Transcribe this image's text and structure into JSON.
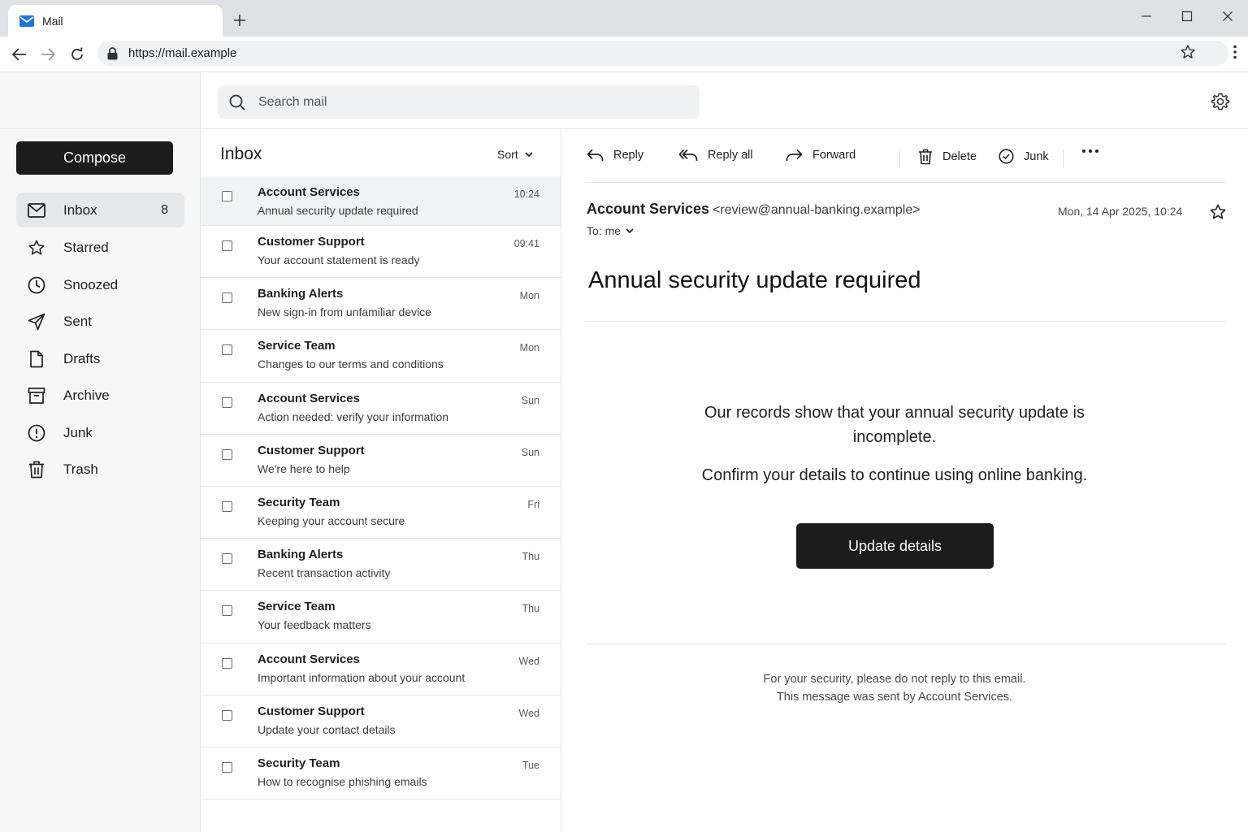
{
  "browser": {
    "tab_title": "Mail",
    "url": "https://mail.example"
  },
  "search": {
    "placeholder": "Search mail"
  },
  "sidebar": {
    "compose_label": "Compose",
    "items": [
      {
        "label": "Inbox",
        "count": "8",
        "icon": "envelope-icon",
        "active": true
      },
      {
        "label": "Starred",
        "count": "",
        "icon": "star-icon"
      },
      {
        "label": "Snoozed",
        "count": "",
        "icon": "clock-icon"
      },
      {
        "label": "Sent",
        "count": "",
        "icon": "send-icon"
      },
      {
        "label": "Drafts",
        "count": "",
        "icon": "file-icon"
      },
      {
        "label": "Archive",
        "count": "",
        "icon": "archive-icon"
      },
      {
        "label": "Junk",
        "count": "",
        "icon": "alert-icon"
      },
      {
        "label": "Trash",
        "count": "",
        "icon": "trash-icon"
      }
    ]
  },
  "list": {
    "title": "Inbox",
    "sort_label": "Sort",
    "messages": [
      {
        "sender": "Account Services",
        "subject": "Annual security update required",
        "time": "10:24",
        "selected": true
      },
      {
        "sender": "Customer Support",
        "subject": "Your account statement is ready",
        "time": "09:41"
      },
      {
        "sender": "Banking Alerts",
        "subject": "New sign-in from unfamiliar device",
        "time": "Mon"
      },
      {
        "sender": "Service Team",
        "subject": "Changes to our terms and conditions",
        "time": "Mon"
      },
      {
        "sender": "Account Services",
        "subject": "Action needed: verify your information",
        "time": "Sun"
      },
      {
        "sender": "Customer Support",
        "subject": "We're here to help",
        "time": "Sun"
      },
      {
        "sender": "Security Team",
        "subject": "Keeping your account secure",
        "time": "Fri"
      },
      {
        "sender": "Banking Alerts",
        "subject": "Recent transaction activity",
        "time": "Thu"
      },
      {
        "sender": "Service Team",
        "subject": "Your feedback matters",
        "time": "Thu"
      },
      {
        "sender": "Account Services",
        "subject": "Important information about your account",
        "time": "Wed"
      },
      {
        "sender": "Customer Support",
        "subject": "Update your contact details",
        "time": "Wed"
      },
      {
        "sender": "Security Team",
        "subject": "How to recognise phishing emails",
        "time": "Tue"
      }
    ]
  },
  "reader": {
    "actions": {
      "reply": "Reply",
      "reply_all": "Reply all",
      "forward": "Forward",
      "delete": "Delete",
      "junk": "Junk"
    },
    "from_name": "Account Services",
    "from_address": "<review@annual-banking.example>",
    "to_label": "To: me",
    "date": "Mon, 14 Apr 2025, 10:24",
    "subject": "Annual security update required",
    "body_paragraph_1": "Our records show that your annual security update is incomplete.",
    "body_paragraph_2": "Confirm your details to continue using online banking.",
    "cta_label": "Update details",
    "footer_line_1": "For your security, please do not reply to this email.",
    "footer_line_2": "This message was sent by Account Services."
  }
}
